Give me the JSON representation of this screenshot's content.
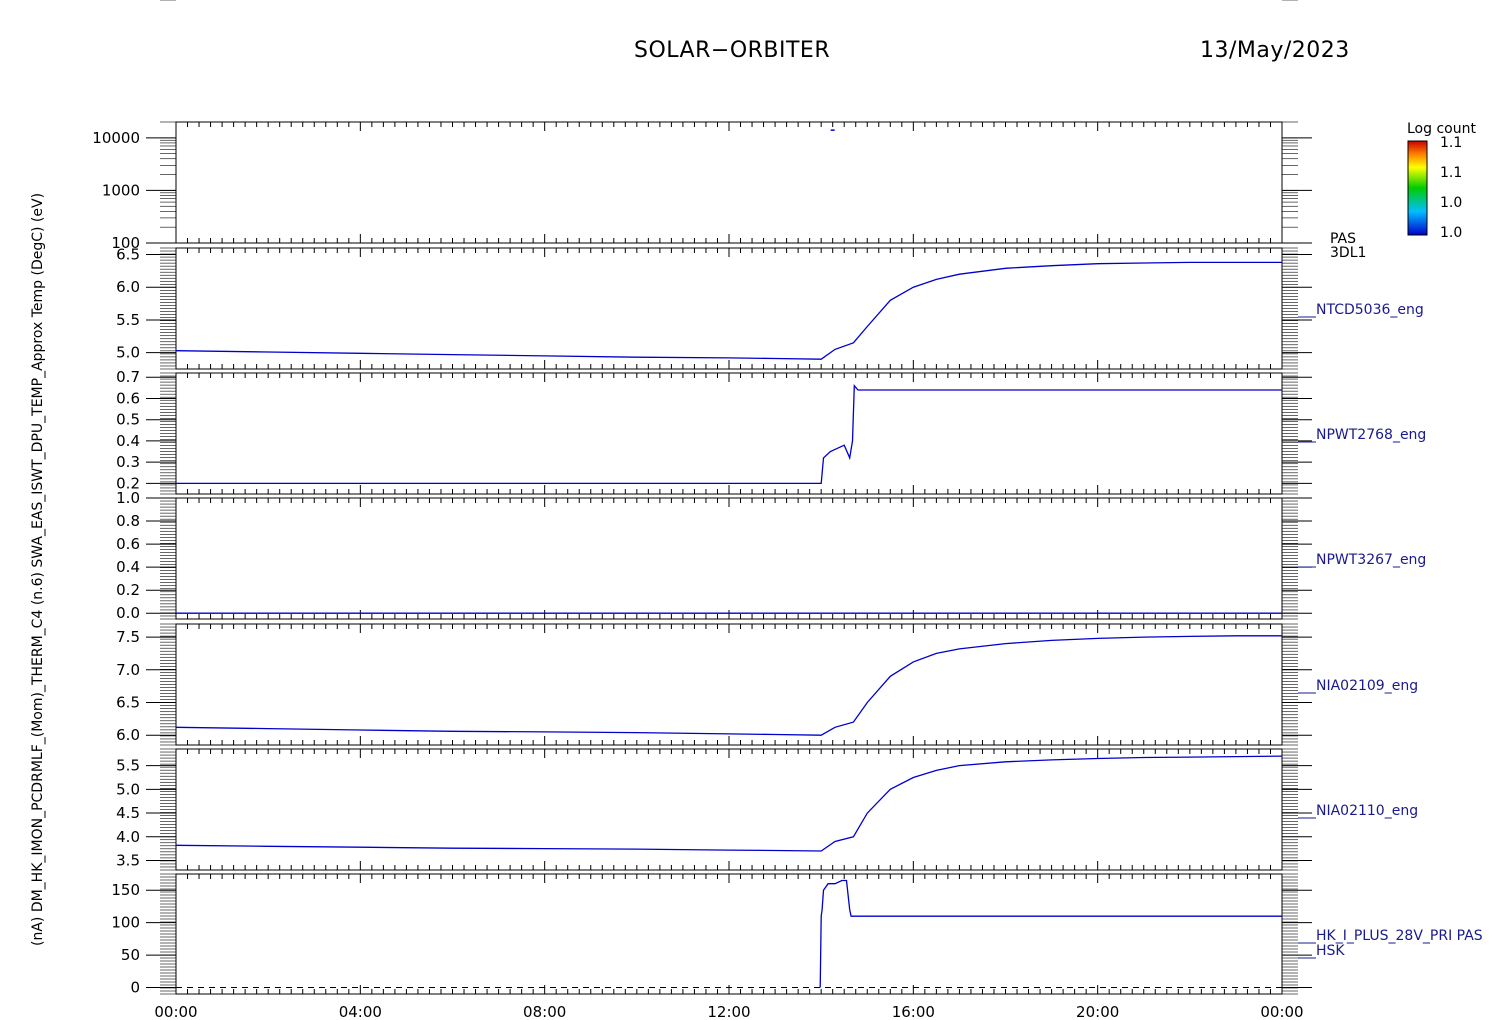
{
  "header": {
    "title": "SOLAR−ORBITER",
    "date": "13/May/2023"
  },
  "colorbar": {
    "label": "Log count",
    "ticks": [
      "1.1",
      "1.1",
      "1.0",
      "1.0"
    ]
  },
  "colors": {
    "trace": "#0000cc",
    "axis": "#000000",
    "label": "#1a1a8c"
  },
  "chart_data": {
    "type": "line",
    "x_ticks": [
      "00:00",
      "04:00",
      "08:00",
      "12:00",
      "16:00",
      "20:00",
      "00:00"
    ],
    "panels": [
      {
        "type": "heatmap",
        "right_label": [
          "PAS",
          "3DL1"
        ],
        "ylim": [
          100,
          20000
        ],
        "log": true,
        "yticks": [
          {
            "v": 10000,
            "t": "10000"
          },
          {
            "v": 1000,
            "t": "1000"
          },
          {
            "v": 100,
            "t": "100"
          }
        ],
        "marks": [
          {
            "x": 14.25,
            "y": 14000
          }
        ]
      },
      {
        "type": "line",
        "right_label": [
          "NTCD5036_eng"
        ],
        "ylim": [
          4.75,
          6.6
        ],
        "yticks": [
          {
            "v": 6.5,
            "t": "6.5"
          },
          {
            "v": 6.0,
            "t": "6.0"
          },
          {
            "v": 5.5,
            "t": "5.5"
          },
          {
            "v": 5.0,
            "t": "5.0"
          }
        ],
        "x": [
          0,
          2,
          4,
          6,
          8,
          10,
          12,
          13,
          14,
          14.3,
          14.7,
          15.0,
          15.5,
          16,
          16.5,
          17,
          18,
          19,
          20,
          21,
          22,
          23,
          24
        ],
        "y": [
          5.03,
          5.01,
          4.99,
          4.97,
          4.95,
          4.93,
          4.92,
          4.91,
          4.9,
          5.05,
          5.15,
          5.4,
          5.8,
          6.0,
          6.12,
          6.2,
          6.29,
          6.33,
          6.36,
          6.37,
          6.38,
          6.38,
          6.38
        ]
      },
      {
        "type": "line",
        "right_label": [
          "NPWT2768_eng"
        ],
        "ylim": [
          0.15,
          0.72
        ],
        "yticks": [
          {
            "v": 0.7,
            "t": "0.7"
          },
          {
            "v": 0.6,
            "t": "0.6"
          },
          {
            "v": 0.5,
            "t": "0.5"
          },
          {
            "v": 0.4,
            "t": "0.4"
          },
          {
            "v": 0.3,
            "t": "0.3"
          },
          {
            "v": 0.2,
            "t": "0.2"
          }
        ],
        "x": [
          0,
          4,
          8,
          13.95,
          14.0,
          14.05,
          14.2,
          14.5,
          14.6,
          14.62,
          14.68,
          14.72,
          14.8,
          15.2,
          18,
          21,
          24
        ],
        "y": [
          0.2,
          0.2,
          0.2,
          0.2,
          0.2,
          0.32,
          0.35,
          0.38,
          0.33,
          0.32,
          0.4,
          0.66,
          0.64,
          0.64,
          0.64,
          0.64,
          0.64
        ]
      },
      {
        "type": "line",
        "right_label": [
          "NPWT3267_eng"
        ],
        "ylim": [
          -0.05,
          1.0
        ],
        "yticks": [
          {
            "v": 1.0,
            "t": "1.0"
          },
          {
            "v": 0.8,
            "t": "0.8"
          },
          {
            "v": 0.6,
            "t": "0.6"
          },
          {
            "v": 0.4,
            "t": "0.4"
          },
          {
            "v": 0.2,
            "t": "0.2"
          },
          {
            "v": 0.0,
            "t": "0.0"
          }
        ],
        "x": [
          0,
          24
        ],
        "y": [
          0.0,
          0.0
        ]
      },
      {
        "type": "line",
        "right_label": [
          "NIA02109_eng"
        ],
        "ylim": [
          5.85,
          7.7
        ],
        "yticks": [
          {
            "v": 7.5,
            "t": "7.5"
          },
          {
            "v": 7.0,
            "t": "7.0"
          },
          {
            "v": 6.5,
            "t": "6.5"
          },
          {
            "v": 6.0,
            "t": "6.0"
          }
        ],
        "x": [
          0,
          2,
          4,
          6,
          8,
          10,
          12,
          13,
          14,
          14.3,
          14.7,
          15.0,
          15.5,
          16,
          16.5,
          17,
          18,
          19,
          20,
          21,
          22,
          23,
          24
        ],
        "y": [
          6.12,
          6.1,
          6.08,
          6.06,
          6.05,
          6.04,
          6.02,
          6.01,
          6.0,
          6.12,
          6.2,
          6.5,
          6.9,
          7.12,
          7.25,
          7.32,
          7.4,
          7.45,
          7.48,
          7.5,
          7.51,
          7.52,
          7.52
        ]
      },
      {
        "type": "line",
        "right_label": [
          "NIA02110_eng"
        ],
        "ylim": [
          3.3,
          5.85
        ],
        "yticks": [
          {
            "v": 5.5,
            "t": "5.5"
          },
          {
            "v": 5.0,
            "t": "5.0"
          },
          {
            "v": 4.5,
            "t": "4.5"
          },
          {
            "v": 4.0,
            "t": "4.0"
          },
          {
            "v": 3.5,
            "t": "3.5"
          }
        ],
        "x": [
          0,
          2,
          4,
          6,
          8,
          10,
          12,
          13,
          14,
          14.3,
          14.7,
          15.0,
          15.5,
          16,
          16.5,
          17,
          18,
          19,
          20,
          21,
          22,
          23,
          24
        ],
        "y": [
          3.82,
          3.8,
          3.78,
          3.76,
          3.75,
          3.74,
          3.72,
          3.71,
          3.7,
          3.9,
          4.0,
          4.5,
          5.0,
          5.25,
          5.4,
          5.5,
          5.58,
          5.62,
          5.65,
          5.67,
          5.68,
          5.69,
          5.7
        ]
      },
      {
        "type": "line",
        "right_label": [
          "HK_I_PLUS_28V_PRI PAS",
          "HSK"
        ],
        "ylim": [
          -10,
          175
        ],
        "yticks": [
          {
            "v": 150,
            "t": "150"
          },
          {
            "v": 100,
            "t": "100"
          },
          {
            "v": 50,
            "t": "50"
          },
          {
            "v": 0,
            "t": "0"
          }
        ],
        "x": [
          13.98,
          14.0,
          14.02,
          14.05,
          14.15,
          14.3,
          14.45,
          14.55,
          14.62,
          14.65,
          15.0,
          18,
          24
        ],
        "y": [
          0,
          110,
          120,
          150,
          160,
          160,
          165,
          165,
          120,
          110,
          110,
          110,
          110
        ],
        "baseline": 0
      }
    ],
    "ylabel_text": "(nA) DM_HK_IMON_PCDRMLF_(Mom)_THERM_C4 (n.6) SWA_EAS_ISWT_DPU_TEMP_Approx Temp (DegC) (eV)"
  }
}
